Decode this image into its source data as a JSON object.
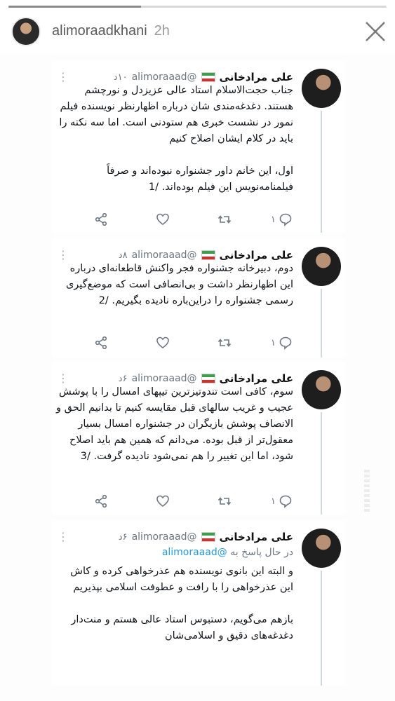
{
  "story": {
    "username": "alimoraadkhani",
    "time": "2h",
    "progress": 0.35
  },
  "colors": {
    "text": "#0f1419",
    "muted": "#6b7680",
    "link": "#1d9bf0"
  },
  "tweets": [
    {
      "name": "علی مرادخانی",
      "handle": "@alimoraaad",
      "time": "۱۰د",
      "body": "جناب حجت‌الاسلام استاد عالی عزیزدل و نورچشم هستند. دغدغه‌مندی شان درباره اظهارنظر نویسنده فیلم نمور در نشست خبری هم ستودنی است. اما سه نکته را باید در کلام ایشان اصلاح کنیم\n\nاول، این خانم داور جشنواره نبوده‌اند و صرفاً فیلمنامه‌نویس این فیلم بوده‌اند. /1",
      "reply_count": "۱"
    },
    {
      "name": "علی مرادخانی",
      "handle": "@alimoraaad",
      "time": "۸د",
      "body": "دوم، دبیرخانه جشنواره فجر واکنش قاطعانه‌ای درباره این اظهارنظر داشت و بی‌انصافی است که موضع‌گیری رسمی جشنواره را دراین‌باره نادیده بگیریم. /2",
      "reply_count": "۱"
    },
    {
      "name": "علی مرادخانی",
      "handle": "@alimoraaad",
      "time": "۶د",
      "body": "سوم، کافی است تندوتیزترین تیپهای امسال را با پوشش عجیب و غریب سالهای قبل مقایسه کنیم تا بدانیم الحق و الانصاف پوشش بازیگران در جشنواره امسال بسیار معقول‌تر از قبل بوده. می‌دانم که همین هم باید اصلاح شود، اما این تغییر را هم نمی‌شود نادیده گرفت. /3",
      "reply_count": "۱"
    },
    {
      "name": "علی مرادخانی",
      "handle": "@alimoraaad",
      "time": "۶د",
      "reply_prefix": "در حال پاسخ به",
      "reply_mention": "@alimoraaad",
      "body": "و البته این بانوی نویسنده هم عذرخواهی کرده و کاش این عذرخواهی را با رافت و عطوفت اسلامی بپذیریم\n\nبازهم می‌گویم، دستبوس استاد عالی هستم و منت‌دار دغدغه‌های دقیق و اسلامی‌شان"
    }
  ]
}
